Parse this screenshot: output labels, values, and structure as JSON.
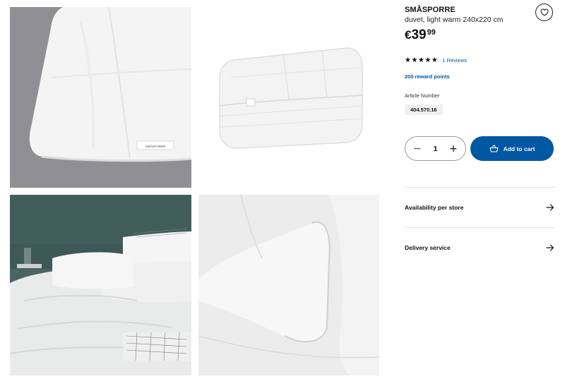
{
  "product": {
    "name": "SMÅSPORRE",
    "description": "duvet, light warm 240x220 cm",
    "price": {
      "currency": "€",
      "integer": "39",
      "decimal": "99"
    },
    "rating": {
      "stars": "★★★★★",
      "value": 5,
      "max": 5,
      "reviews_label": "1 Reviews"
    },
    "reward_points": "200 reward points",
    "article_label": "Article Number",
    "article_number": "404.570.16"
  },
  "purchase": {
    "quantity": "1",
    "minus": "−",
    "plus": "+",
    "add_to_cart_label": "Add to cart"
  },
  "links": {
    "availability": "Availability per store",
    "delivery": "Delivery service"
  },
  "icons": {
    "wishlist": "heart-icon",
    "cart": "cart-icon",
    "arrow": "arrow-right-icon"
  },
  "colors": {
    "accent": "#0058a3",
    "text": "#111111",
    "divider": "#e5e5e5"
  },
  "gallery": {
    "image_count": 4,
    "tag_text": "SMÅSPORRE"
  }
}
